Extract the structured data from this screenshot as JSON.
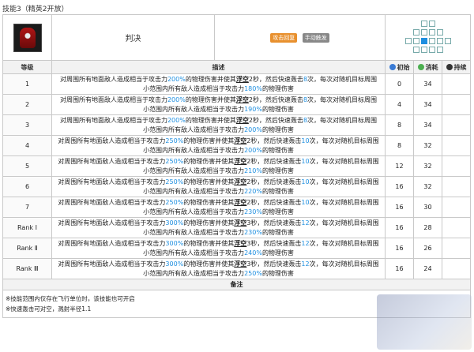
{
  "section_title": "技能3（精英2开放）",
  "skill": {
    "name": "判决",
    "icon": "skill-judgement-icon",
    "tags": [
      "攻击回复",
      "手动触发"
    ]
  },
  "headers": {
    "level": "等级",
    "description": "描述",
    "initial": "初始",
    "cost": "消耗",
    "duration": "持续"
  },
  "text": {
    "p1": "对周围所有地面敌人造成相当于攻击力",
    "p2": "的物理伤害并使其",
    "float": "浮空",
    "p3": "秒，然后快速轰击",
    "p4": "次，每次对随机目标周围",
    "p5": "小范围内所有敌人造成相当于攻击力",
    "p6": "的物理伤害"
  },
  "levels": [
    {
      "level": "1",
      "dmg1": "200%",
      "float_sec": "2",
      "hits": "8",
      "dmg2": "180%",
      "initial": "0",
      "cost": "34",
      "duration": ""
    },
    {
      "level": "2",
      "dmg1": "200%",
      "float_sec": "2",
      "hits": "8",
      "dmg2": "190%",
      "initial": "4",
      "cost": "34",
      "duration": ""
    },
    {
      "level": "3",
      "dmg1": "200%",
      "float_sec": "2",
      "hits": "8",
      "dmg2": "200%",
      "initial": "8",
      "cost": "34",
      "duration": ""
    },
    {
      "level": "4",
      "dmg1": "250%",
      "float_sec": "2",
      "hits": "10",
      "dmg2": "200%",
      "initial": "8",
      "cost": "32",
      "duration": ""
    },
    {
      "level": "5",
      "dmg1": "250%",
      "float_sec": "2",
      "hits": "10",
      "dmg2": "210%",
      "initial": "12",
      "cost": "32",
      "duration": ""
    },
    {
      "level": "6",
      "dmg1": "250%",
      "float_sec": "2",
      "hits": "10",
      "dmg2": "220%",
      "initial": "16",
      "cost": "32",
      "duration": ""
    },
    {
      "level": "7",
      "dmg1": "250%",
      "float_sec": "2",
      "hits": "10",
      "dmg2": "230%",
      "initial": "16",
      "cost": "30",
      "duration": ""
    },
    {
      "level": "Rank Ⅰ",
      "dmg1": "300%",
      "float_sec": "3",
      "hits": "12",
      "dmg2": "230%",
      "initial": "16",
      "cost": "28",
      "duration": ""
    },
    {
      "level": "Rank Ⅱ",
      "dmg1": "300%",
      "float_sec": "3",
      "hits": "12",
      "dmg2": "240%",
      "initial": "16",
      "cost": "26",
      "duration": ""
    },
    {
      "level": "Rank Ⅲ",
      "dmg1": "300%",
      "float_sec": "3",
      "hits": "12",
      "dmg2": "250%",
      "initial": "16",
      "cost": "24",
      "duration": ""
    }
  ],
  "notes": {
    "header": "备注",
    "lines": [
      "※技能范围内仅存在飞行单位时，该技能也可开启",
      "※快速轰击可对空，溅射半径1.1"
    ]
  },
  "colors": {
    "highlight": "#1e8fe0",
    "tag_orange": "#e8902e",
    "tag_grey": "#888888",
    "header_bg": "#f2f2f2"
  }
}
